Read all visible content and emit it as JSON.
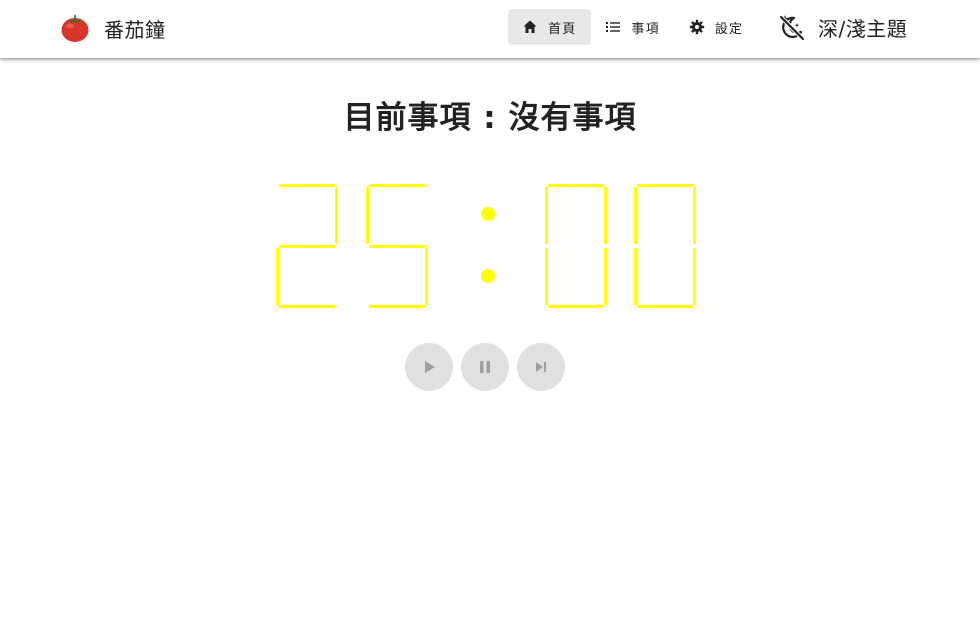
{
  "header": {
    "app_name": "番茄鐘",
    "logo_icon": "tomato-icon",
    "nav": [
      {
        "label": "首頁",
        "icon": "home-icon",
        "active": true
      },
      {
        "label": "事項",
        "icon": "list-icon",
        "active": false
      },
      {
        "label": "設定",
        "icon": "gear-icon",
        "active": false
      }
    ],
    "theme_toggle": {
      "label": "深/淺主題",
      "icon": "theme-toggle-icon"
    }
  },
  "main": {
    "title": "目前事項 : 沒有事項",
    "timer": {
      "minutes": "25",
      "seconds": "00",
      "color": "#ffff00"
    },
    "controls": [
      {
        "name": "play",
        "icon": "play-icon"
      },
      {
        "name": "pause",
        "icon": "pause-icon"
      },
      {
        "name": "skip",
        "icon": "skip-next-icon"
      }
    ]
  },
  "colors": {
    "digit": "#ffff00",
    "control_bg": "#e0e0e0",
    "control_icon": "#9e9e9e",
    "active_nav_bg": "#e8e8e8"
  }
}
